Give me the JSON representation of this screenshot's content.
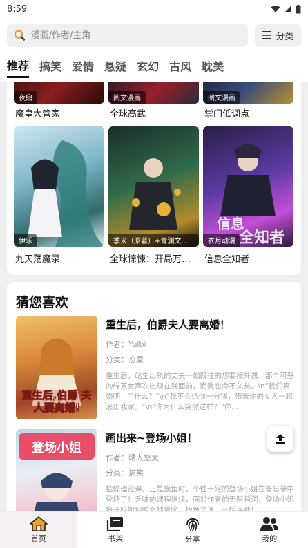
{
  "status_bar": {
    "time": "8:59"
  },
  "search": {
    "placeholder": "漫画/作者/主角"
  },
  "category_button": {
    "label": "分类"
  },
  "tabs": [
    {
      "label": "推荐",
      "active": true
    },
    {
      "label": "搞笑"
    },
    {
      "label": "爱情"
    },
    {
      "label": "悬疑"
    },
    {
      "label": "玄幻"
    },
    {
      "label": "古风"
    },
    {
      "label": "耽美"
    }
  ],
  "grid_top": [
    {
      "title": "魔皇大管家",
      "badge": "夜鼎"
    },
    {
      "title": "全球高武",
      "badge": "阅文漫画"
    },
    {
      "title": "掌门低调点",
      "badge": "阅文漫画"
    }
  ],
  "grid_bottom": [
    {
      "title": "九天荡魔录",
      "badge": "伊乐"
    },
    {
      "title": "全球惊悚：开局万…",
      "badge": "季米（原著）+青渊文化…"
    },
    {
      "title": "信息全知者",
      "badge": "衣月动漫"
    }
  ],
  "guess": {
    "heading": "猜您喜欢",
    "items": [
      {
        "title": "重生后，伯爵夫人要离婚！",
        "author": "作者：Yulbi",
        "category": "分类：恋爱",
        "desc": "重生后，站生出轨的丈夫一如既往的想要掠外遇，那个可恶的绿茶女声次出现在我面前，而我也命不久矣。\\n\"我们离婚吧！\"\"什么？\"\\n\"我不会给你一分钱，带着你的女人一起滚出我家。\"\\n\"你为什么突然这样？\"你…",
        "cover_text": "重生后,伯爵 夫人要离婚!"
      },
      {
        "title": "画出来~登场小姐！",
        "author": "作者：晴人悠太",
        "category": "分类：搞笑",
        "desc": "枯燥理论课，正是摸鱼时。个性十足的登场小姐在备忘录中登场了！乏味的课程继续，面对作者的无限瞬洞，登场小姐将开始如何的奇妙冒险…摸鱼之道，开始连载！",
        "cover_text": "登场小姐"
      }
    ]
  },
  "bottom_nav": [
    {
      "label": "首页",
      "icon": "home-icon",
      "active": true
    },
    {
      "label": "书架",
      "icon": "bookshelf-icon"
    },
    {
      "label": "分享",
      "icon": "fingerprint-icon"
    },
    {
      "label": "我的",
      "icon": "users-icon"
    }
  ],
  "colors": {
    "accent_orange": "#f0a22a",
    "text_dark": "#111111",
    "meta_gray": "#999999"
  }
}
